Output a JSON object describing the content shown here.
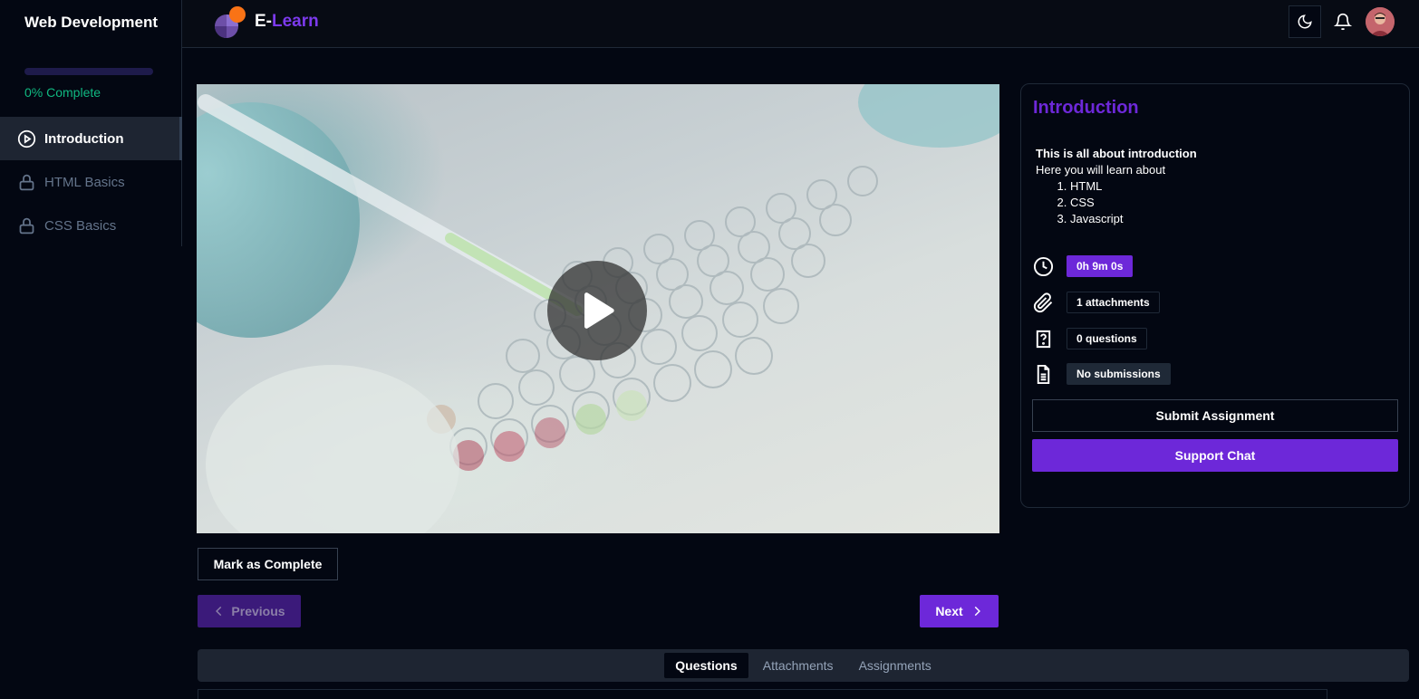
{
  "sidebar": {
    "course_title": "Web Development",
    "progress_percent": 0,
    "progress_text": "0% Complete",
    "chapters": [
      {
        "label": "Introduction",
        "state": "active",
        "icon": "play-circle-icon"
      },
      {
        "label": "HTML Basics",
        "state": "locked",
        "icon": "lock-icon"
      },
      {
        "label": "CSS Basics",
        "state": "locked",
        "icon": "lock-icon"
      }
    ]
  },
  "header": {
    "brand_prefix": "E-",
    "brand_suffix": "Learn",
    "icons": [
      "moon-icon",
      "bell-icon",
      "user-avatar"
    ]
  },
  "video": {
    "play_icon": "play-icon"
  },
  "chapter_info": {
    "title": "Introduction",
    "description_heading": "This is all about introduction",
    "description_intro": "Here you will learn about",
    "topics": [
      "HTML",
      "CSS",
      "Javascript"
    ],
    "duration": "0h 9m 0s",
    "attachments": "1 attachments",
    "questions": "0 questions",
    "submissions": "No submissions",
    "submit_label": "Submit Assignment",
    "support_label": "Support Chat"
  },
  "actions": {
    "mark_complete": "Mark as Complete",
    "previous": "Previous",
    "next": "Next"
  },
  "tabs": [
    "Questions",
    "Attachments",
    "Assignments"
  ],
  "colors": {
    "accent": "#6d28d9",
    "success": "#10b981",
    "background": "#030712",
    "logo_orange": "#f97316"
  }
}
